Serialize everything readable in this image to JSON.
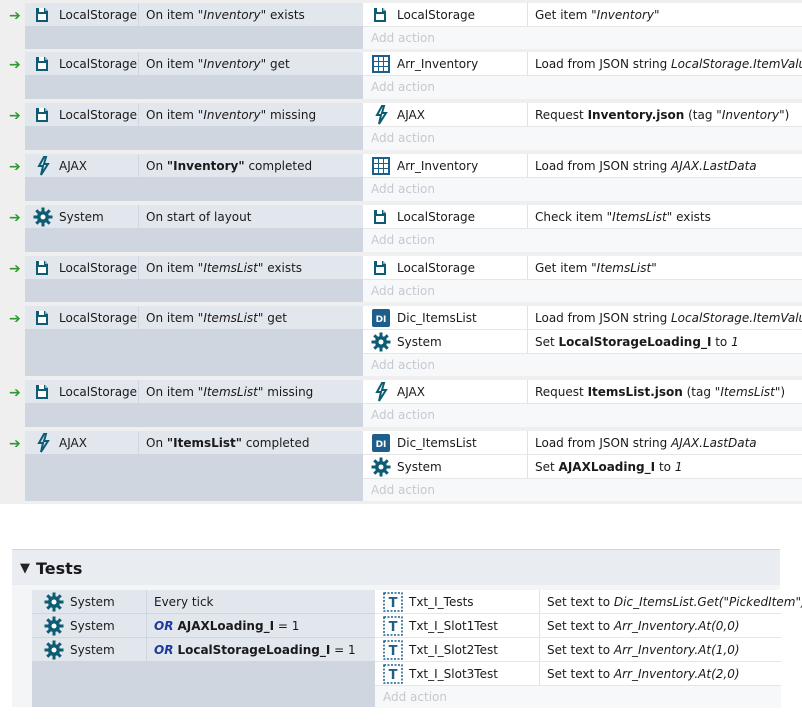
{
  "events": [
    {
      "conditions": [
        {
          "object": "LocalStorage",
          "icon": "localstorage-icon",
          "text": {
            "pre": "On item ",
            "italic": "\"Inventory\"",
            "post": " exists"
          }
        }
      ],
      "actions": [
        {
          "object": "LocalStorage",
          "icon": "localstorage-icon",
          "text": {
            "pre": "Get item ",
            "italic": "\"Inventory\"",
            "post": ""
          }
        }
      ]
    },
    {
      "conditions": [
        {
          "object": "LocalStorage",
          "icon": "localstorage-icon",
          "text": {
            "pre": "On item ",
            "italic": "\"Inventory\"",
            "post": " get"
          }
        }
      ],
      "actions": [
        {
          "object": "Arr_Inventory",
          "icon": "array-icon",
          "text": {
            "pre": "Load from JSON string ",
            "italic": "LocalStorage.ItemValue",
            "post": ""
          }
        }
      ]
    },
    {
      "conditions": [
        {
          "object": "LocalStorage",
          "icon": "localstorage-icon",
          "text": {
            "pre": "On item ",
            "italic": "\"Inventory\"",
            "post": " missing"
          }
        }
      ],
      "actions": [
        {
          "object": "AJAX",
          "icon": "ajax-icon",
          "text": {
            "pre": "Request ",
            "bold": "Inventory.json",
            "mid": " (tag ",
            "italic": "\"Inventory\"",
            "post": ")"
          }
        }
      ]
    },
    {
      "conditions": [
        {
          "object": "AJAX",
          "icon": "ajax-icon",
          "text": {
            "pre": "On ",
            "bold": "\"Inventory\"",
            "post": " completed"
          }
        }
      ],
      "actions": [
        {
          "object": "Arr_Inventory",
          "icon": "array-icon",
          "text": {
            "pre": "Load from JSON string ",
            "italic": "AJAX.LastData",
            "post": ""
          }
        }
      ]
    },
    {
      "conditions": [
        {
          "object": "System",
          "icon": "system-gear-icon",
          "text": {
            "pre": "On start of layout",
            "post": ""
          }
        }
      ],
      "actions": [
        {
          "object": "LocalStorage",
          "icon": "localstorage-icon",
          "text": {
            "pre": "Check item ",
            "italic": "\"ItemsList\"",
            "post": " exists"
          }
        }
      ]
    },
    {
      "conditions": [
        {
          "object": "LocalStorage",
          "icon": "localstorage-icon",
          "text": {
            "pre": "On item ",
            "italic": "\"ItemsList\"",
            "post": " exists"
          }
        }
      ],
      "actions": [
        {
          "object": "LocalStorage",
          "icon": "localstorage-icon",
          "text": {
            "pre": "Get item ",
            "italic": "\"ItemsList\"",
            "post": ""
          }
        }
      ]
    },
    {
      "conditions": [
        {
          "object": "LocalStorage",
          "icon": "localstorage-icon",
          "text": {
            "pre": "On item ",
            "italic": "\"ItemsList\"",
            "post": " get"
          }
        }
      ],
      "actions": [
        {
          "object": "Dic_ItemsList",
          "icon": "dictionary-icon",
          "text": {
            "pre": "Load from JSON string ",
            "italic": "LocalStorage.ItemValue",
            "post": ""
          }
        },
        {
          "object": "System",
          "icon": "system-gear-icon",
          "text": {
            "pre": "Set ",
            "bold": "LocalStorageLoading_I",
            "mid": " to ",
            "italic": "1",
            "post": ""
          }
        }
      ]
    },
    {
      "conditions": [
        {
          "object": "LocalStorage",
          "icon": "localstorage-icon",
          "text": {
            "pre": "On item ",
            "italic": "\"ItemsList\"",
            "post": " missing"
          }
        }
      ],
      "actions": [
        {
          "object": "AJAX",
          "icon": "ajax-icon",
          "text": {
            "pre": "Request ",
            "bold": "ItemsList.json",
            "mid": " (tag ",
            "italic": "\"ItemsList\"",
            "post": ")"
          }
        }
      ]
    },
    {
      "conditions": [
        {
          "object": "AJAX",
          "icon": "ajax-icon",
          "text": {
            "pre": "On ",
            "bold": "\"ItemsList\"",
            "post": " completed"
          }
        }
      ],
      "actions": [
        {
          "object": "Dic_ItemsList",
          "icon": "dictionary-icon",
          "text": {
            "pre": "Load from JSON string ",
            "italic": "AJAX.LastData",
            "post": ""
          }
        },
        {
          "object": "System",
          "icon": "system-gear-icon",
          "text": {
            "pre": "Set ",
            "bold": "AJAXLoading_I",
            "mid": " to ",
            "italic": "1",
            "post": ""
          }
        }
      ]
    }
  ],
  "add_action_label": "Add action",
  "tests_group": {
    "title": "Tests",
    "conditions": [
      {
        "object": "System",
        "icon": "system-gear-icon",
        "or": "",
        "text": {
          "pre": "Every tick",
          "post": ""
        }
      },
      {
        "object": "System",
        "icon": "system-gear-icon",
        "or": "OR",
        "text": {
          "bold": "AJAXLoading_I",
          "post": " = 1"
        }
      },
      {
        "object": "System",
        "icon": "system-gear-icon",
        "or": "OR",
        "text": {
          "bold": "LocalStorageLoading_I",
          "post": " = 1"
        }
      }
    ],
    "actions": [
      {
        "object": "Txt_I_Tests",
        "icon": "text-object-icon",
        "text": {
          "pre": "Set text to ",
          "italic": "Dic_ItemsList.Get(\"PickedItem\")",
          "post": ""
        }
      },
      {
        "object": "Txt_I_Slot1Test",
        "icon": "text-object-icon",
        "text": {
          "pre": "Set text to ",
          "italic": "Arr_Inventory.At(0,0)",
          "post": ""
        }
      },
      {
        "object": "Txt_I_Slot2Test",
        "icon": "text-object-icon",
        "text": {
          "pre": "Set text to ",
          "italic": "Arr_Inventory.At(1,0)",
          "post": ""
        }
      },
      {
        "object": "Txt_I_Slot3Test",
        "icon": "text-object-icon",
        "text": {
          "pre": "Set text to ",
          "italic": "Arr_Inventory.At(2,0)",
          "post": ""
        }
      }
    ]
  },
  "colors": {
    "arrow": "#2e9a2e",
    "or_keyword": "#1f3a9c",
    "icon_teal": "#0d5c73",
    "icon_blue": "#1d5f8a"
  }
}
